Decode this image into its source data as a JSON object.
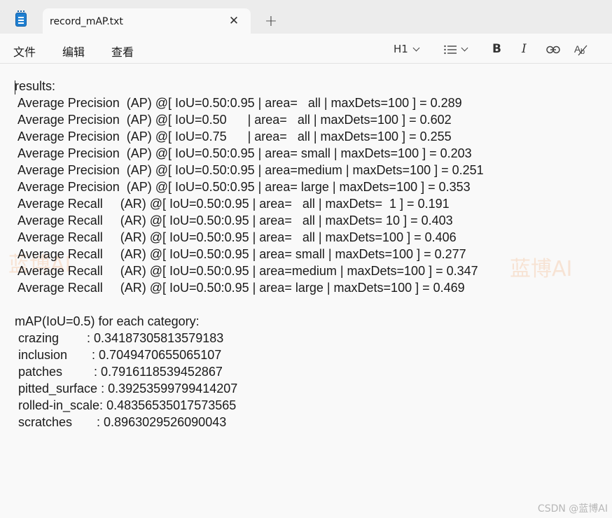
{
  "tab": {
    "title": "record_mAP.txt",
    "close_icon": "close-icon",
    "new_tab_symbol": "+"
  },
  "menu": {
    "file": "文件",
    "edit": "编辑",
    "view": "查看"
  },
  "toolbar": {
    "heading": "H1",
    "list_icon": "list-icon",
    "bold": "B",
    "italic": "I",
    "link_icon": "link-icon",
    "clear_format_icon": "clear-format-icon"
  },
  "document": {
    "lines": [
      "results:",
      " Average Precision  (AP) @[ IoU=0.50:0.95 | area=   all | maxDets=100 ] = 0.289",
      " Average Precision  (AP) @[ IoU=0.50      | area=   all | maxDets=100 ] = 0.602",
      " Average Precision  (AP) @[ IoU=0.75      | area=   all | maxDets=100 ] = 0.255",
      " Average Precision  (AP) @[ IoU=0.50:0.95 | area= small | maxDets=100 ] = 0.203",
      " Average Precision  (AP) @[ IoU=0.50:0.95 | area=medium | maxDets=100 ] = 0.251",
      " Average Precision  (AP) @[ IoU=0.50:0.95 | area= large | maxDets=100 ] = 0.353",
      " Average Recall     (AR) @[ IoU=0.50:0.95 | area=   all | maxDets=  1 ] = 0.191",
      " Average Recall     (AR) @[ IoU=0.50:0.95 | area=   all | maxDets= 10 ] = 0.403",
      " Average Recall     (AR) @[ IoU=0.50:0.95 | area=   all | maxDets=100 ] = 0.406",
      " Average Recall     (AR) @[ IoU=0.50:0.95 | area= small | maxDets=100 ] = 0.277",
      " Average Recall     (AR) @[ IoU=0.50:0.95 | area=medium | maxDets=100 ] = 0.347",
      " Average Recall     (AR) @[ IoU=0.50:0.95 | area= large | maxDets=100 ] = 0.469",
      "",
      "mAP(IoU=0.5) for each category:",
      " crazing        : 0.34187305813579183",
      " inclusion       : 0.7049470655065107",
      " patches         : 0.7916118539452867",
      " pitted_surface : 0.39253599799414207",
      " rolled-in_scale: 0.48356535017573565",
      " scratches       : 0.8963029526090043"
    ]
  },
  "watermarks": {
    "left": "蓝博AI",
    "right": "蓝博AI",
    "csdn": "CSDN @蓝博AI"
  },
  "colors": {
    "window_bg": "#f9f9f9",
    "titlebar_bg": "#ececec",
    "watermark": "#f09650"
  }
}
